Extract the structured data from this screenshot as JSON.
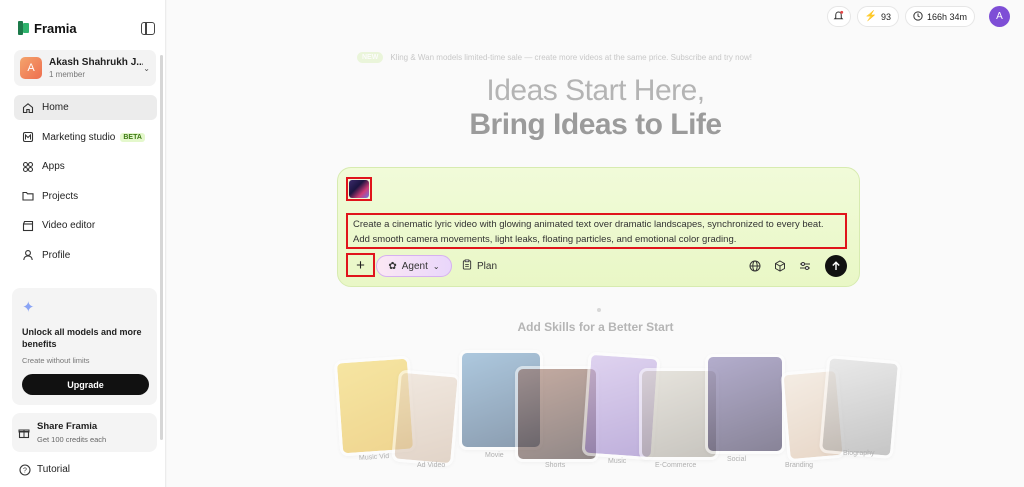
{
  "sidebar": {
    "brand": "Framia",
    "account": {
      "initial": "A",
      "name": "Akash Shahrukh J...",
      "members": "1 member"
    },
    "nav": [
      {
        "label": "Home",
        "icon": "home-icon",
        "active": true
      },
      {
        "label": "Marketing studio",
        "icon": "marketing-icon",
        "badge": "BETA"
      },
      {
        "label": "Apps",
        "icon": "apps-icon"
      },
      {
        "label": "Projects",
        "icon": "folder-icon"
      },
      {
        "label": "Video editor",
        "icon": "clapperboard-icon"
      },
      {
        "label": "Profile",
        "icon": "user-icon"
      }
    ],
    "promo": {
      "title": "Unlock all models and more benefits",
      "subtitle": "Create without limits",
      "button": "Upgrade"
    },
    "share": {
      "title": "Share Framia",
      "subtitle": "Get 100 credits each"
    },
    "tutorial": "Tutorial"
  },
  "topbar": {
    "credits": "93",
    "time_left": "166h 34m",
    "avatar_initial": "A"
  },
  "announcement": {
    "badge": "NEW",
    "text": "Kling & Wan models limited-time sale — create more videos at the same price. Subscribe and try now!"
  },
  "hero": {
    "line1": "Ideas Start Here,",
    "line2": "Bring Ideas to Life"
  },
  "composer": {
    "prompt": "Create a cinematic lyric video with glowing animated text over dramatic landscapes, synchronized to every beat. Add smooth camera movements, light leaks, floating particles, and emotional color grading.",
    "add_button": "+",
    "agent_label": "Agent",
    "plan_label": "Plan"
  },
  "skills": {
    "title": "Add Skills for a Better Start",
    "cards": [
      "Music Vid",
      "Ad Video",
      "Movie",
      "Shorts",
      "Music",
      "E-Commerce",
      "Social",
      "Branding",
      "Biography"
    ]
  },
  "colors": {
    "highlight": "#e0141b",
    "brand_green": "#2fb36d",
    "composer_bg": "#eef9d3",
    "avatar": "#7e4ed6"
  }
}
